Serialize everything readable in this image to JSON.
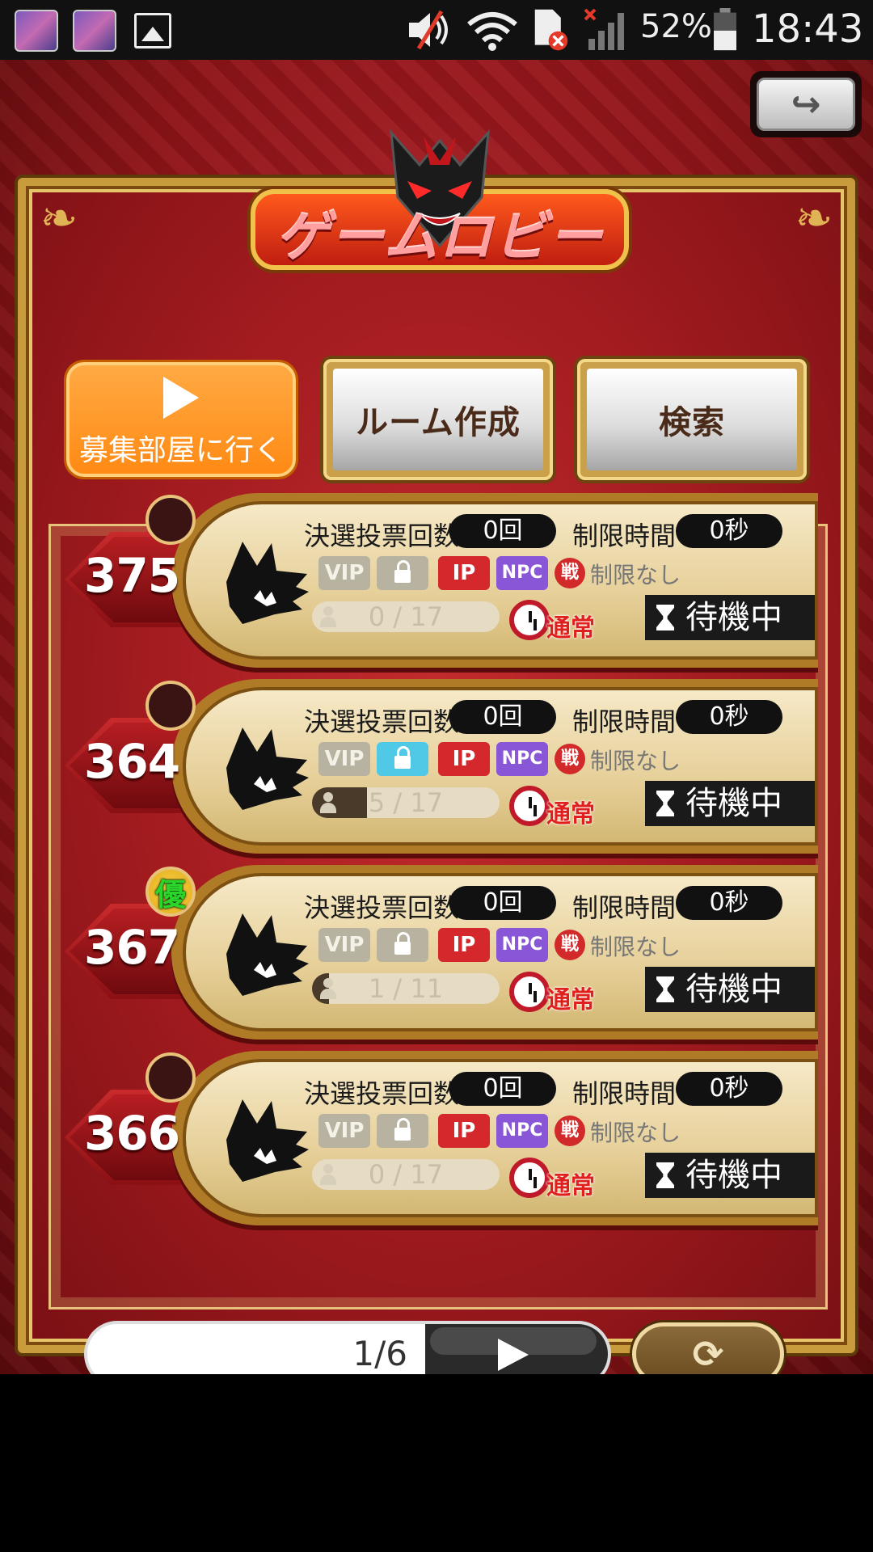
{
  "status_bar": {
    "battery": "52%",
    "time": "18:43"
  },
  "header": {
    "title": "ゲームロビー"
  },
  "actions": {
    "recruit_label": "募集部屋に行く",
    "create_room_label": "ルーム作成",
    "search_label": "検索"
  },
  "rooms": [
    {
      "number": "375",
      "badge": "",
      "votes_label": "決選投票回数",
      "votes": "0回",
      "time_label": "制限時間",
      "time": "0秒",
      "vip": "VIP",
      "ip": "IP",
      "npc": "NPC",
      "battle_icon": "戦",
      "limit": "制限なし",
      "locked": false,
      "players": "0 / 17",
      "players_fraction": 0.0,
      "mode": "通常",
      "status": "待機中"
    },
    {
      "number": "364",
      "badge": "",
      "votes_label": "決選投票回数",
      "votes": "0回",
      "time_label": "制限時間",
      "time": "0秒",
      "vip": "VIP",
      "ip": "IP",
      "npc": "NPC",
      "battle_icon": "戦",
      "limit": "制限なし",
      "locked": true,
      "players": "5 / 17",
      "players_fraction": 0.294,
      "mode": "通常",
      "status": "待機中"
    },
    {
      "number": "367",
      "badge": "優",
      "votes_label": "決選投票回数",
      "votes": "0回",
      "time_label": "制限時間",
      "time": "0秒",
      "vip": "VIP",
      "ip": "IP",
      "npc": "NPC",
      "battle_icon": "戦",
      "limit": "制限なし",
      "locked": false,
      "players": "1 / 11",
      "players_fraction": 0.091,
      "mode": "通常",
      "status": "待機中"
    },
    {
      "number": "366",
      "badge": "",
      "votes_label": "決選投票回数",
      "votes": "0回",
      "time_label": "制限時間",
      "time": "0秒",
      "vip": "VIP",
      "ip": "IP",
      "npc": "NPC",
      "battle_icon": "戦",
      "limit": "制限なし",
      "locked": false,
      "players": "0 / 17",
      "players_fraction": 0.0,
      "mode": "通常",
      "status": "待機中"
    }
  ],
  "pager": {
    "page": "1/6"
  },
  "icons": {
    "back": "back-arrow-icon",
    "refresh": "refresh-icon",
    "next": "play-icon"
  },
  "colors": {
    "background_red": "#9f1a1e",
    "gold": "#c89b3c",
    "recruit_orange": "#ff8a14",
    "ip_red": "#d4282d",
    "npc_purple": "#8a56d8",
    "lock_on_blue": "#4fc9e6"
  }
}
